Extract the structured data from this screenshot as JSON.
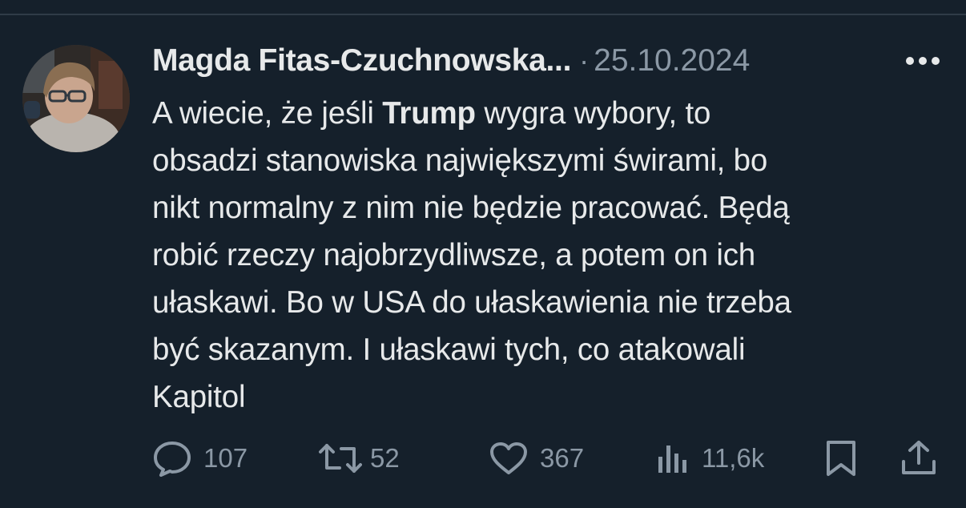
{
  "author": {
    "display_name": "Magda Fitas-Czuchnowska...",
    "separator": "·",
    "date": "25.10.2024",
    "avatar_icon": "profile-photo"
  },
  "tweet": {
    "lines": [
      [
        "A wiecie, że jeśli ",
        "Trump",
        " wygra wybory, to"
      ],
      "obsadzi stanowiska największymi świrami, bo",
      "nikt normalny z nim nie będzie pracować. Będą",
      "robić rzeczy najobrzydliwsze, a potem on ich",
      "ułaskawi. Bo w USA do ułaskawienia nie trzeba",
      "być skazanym. I ułaskawi tych, co atakowali",
      "Kapitol"
    ]
  },
  "actions": {
    "reply": {
      "icon": "reply-icon",
      "count": "107"
    },
    "retweet": {
      "icon": "retweet-icon",
      "count": "52"
    },
    "like": {
      "icon": "heart-icon",
      "count": "367"
    },
    "views": {
      "icon": "views-icon",
      "count": "11,6k"
    },
    "bookmark": {
      "icon": "bookmark-icon"
    },
    "share": {
      "icon": "share-icon"
    }
  },
  "colors": {
    "background": "#15202b",
    "text_primary": "#e7e9ea",
    "text_secondary": "#8b98a5"
  }
}
